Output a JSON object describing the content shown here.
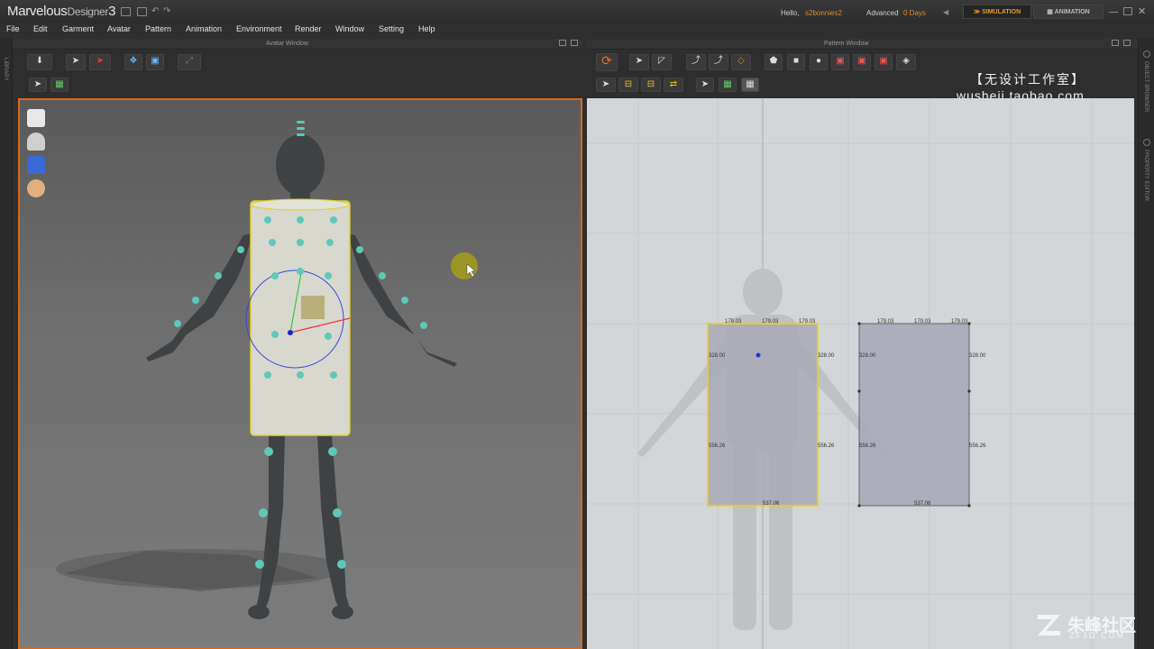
{
  "app": {
    "name": "Marvelous",
    "name_suffix": "Designer",
    "version": "3",
    "hello_label": "Hello,",
    "user": "s2bonnies2",
    "license_label": "Advanced",
    "license_days": "0 Days"
  },
  "modes": {
    "simulation": "SIMULATION",
    "animation": "ANIMATION"
  },
  "menu": [
    "File",
    "Edit",
    "Garment",
    "Avatar",
    "Pattern",
    "Animation",
    "Environment",
    "Render",
    "Window",
    "Setting",
    "Help"
  ],
  "windows": {
    "avatar_title": "Avatar Window",
    "pattern_title": "Pattern Window"
  },
  "side_panels": {
    "left": "LIBRARY",
    "right_top": "OBJECT BROWSER",
    "right_bottom": "PROPERTY EDITOR"
  },
  "watermark": {
    "line1": "【无设计工作室】",
    "line2": "wusheji.taobao.com",
    "brand": "朱峰社区",
    "brand_url": "ZF3D.COM"
  },
  "patterns": {
    "front": {
      "top_left": "179.03",
      "top_mid": "179.03",
      "top_right": "179.03",
      "left_upper": "328.00",
      "right_upper": "328.00",
      "left_lower": "556.26",
      "right_lower": "556.26",
      "bottom": "537.06"
    },
    "back": {
      "top_left": "179.03",
      "top_mid": "179.03",
      "top_right": "179.03",
      "left_upper": "328.00",
      "right_upper": "328.00",
      "left_lower": "556.26",
      "right_lower": "556.26",
      "bottom": "537.06"
    }
  },
  "colors": {
    "accent": "#e08a2a",
    "selection_border": "#d46a21",
    "pattern_fill": "#a9aab8",
    "pattern_selected_outline": "#e3d020",
    "arrangement_point": "#5fc8b8"
  },
  "icons": {
    "avatar_view_tools": [
      "garment-icon",
      "avatar-icon",
      "texture-icon",
      "face-icon"
    ]
  }
}
